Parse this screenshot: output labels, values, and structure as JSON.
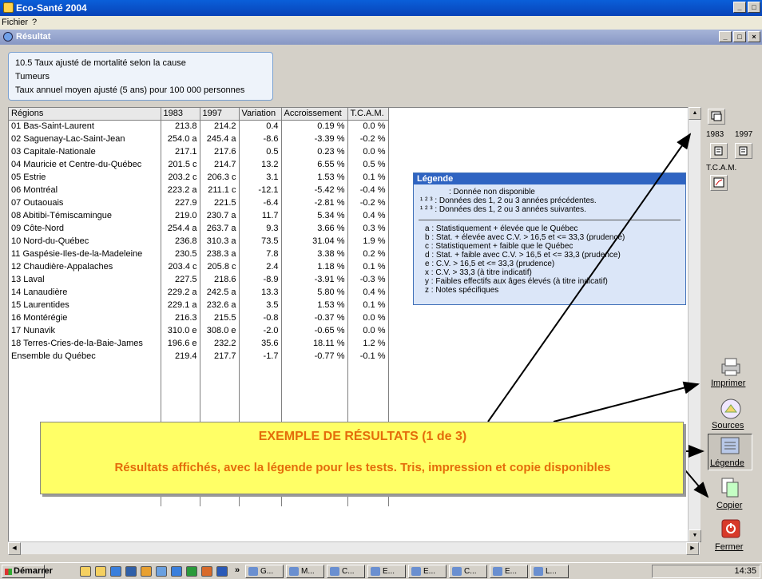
{
  "app": {
    "title": "Eco-Santé 2004",
    "menu": [
      "Fichier",
      "?"
    ]
  },
  "window": {
    "title": "Résultat"
  },
  "info": {
    "line1": "10.5 Taux ajusté de mortalité selon la cause",
    "line2": "Tumeurs",
    "line3": "Taux annuel moyen ajusté (5 ans) pour 100 000 personnes"
  },
  "table": {
    "headers": [
      "Régions",
      "1983",
      "1997",
      "Variation",
      "Accroissement",
      "T.C.A.M."
    ],
    "rows": [
      [
        "01 Bas-Saint-Laurent",
        "213.8",
        "214.2",
        "0.4",
        "0.19 %",
        "0.0 %"
      ],
      [
        "02 Saguenay-Lac-Saint-Jean",
        "254.0 a",
        "245.4 a",
        "-8.6",
        "-3.39 %",
        "-0.2 %"
      ],
      [
        "03 Capitale-Nationale",
        "217.1",
        "217.6",
        "0.5",
        "0.23 %",
        "0.0 %"
      ],
      [
        "04 Mauricie et Centre-du-Québec",
        "201.5 c",
        "214.7",
        "13.2",
        "6.55 %",
        "0.5 %"
      ],
      [
        "05 Estrie",
        "203.2 c",
        "206.3 c",
        "3.1",
        "1.53 %",
        "0.1 %"
      ],
      [
        "06 Montréal",
        "223.2 a",
        "211.1 c",
        "-12.1",
        "-5.42 %",
        "-0.4 %"
      ],
      [
        "07 Outaouais",
        "227.9",
        "221.5",
        "-6.4",
        "-2.81 %",
        "-0.2 %"
      ],
      [
        "08 Abitibi-Témiscamingue",
        "219.0",
        "230.7 a",
        "11.7",
        "5.34 %",
        "0.4 %"
      ],
      [
        "09 Côte-Nord",
        "254.4 a",
        "263.7 a",
        "9.3",
        "3.66 %",
        "0.3 %"
      ],
      [
        "10 Nord-du-Québec",
        "236.8",
        "310.3 a",
        "73.5",
        "31.04 %",
        "1.9 %"
      ],
      [
        "11 Gaspésie-Iles-de-la-Madeleine",
        "230.5",
        "238.3 a",
        "7.8",
        "3.38 %",
        "0.2 %"
      ],
      [
        "12 Chaudière-Appalaches",
        "203.4 c",
        "205.8 c",
        "2.4",
        "1.18 %",
        "0.1 %"
      ],
      [
        "13 Laval",
        "227.5",
        "218.6",
        "-8.9",
        "-3.91 %",
        "-0.3 %"
      ],
      [
        "14 Lanaudière",
        "229.2 a",
        "242.5 a",
        "13.3",
        "5.80 %",
        "0.4 %"
      ],
      [
        "15 Laurentides",
        "229.1 a",
        "232.6 a",
        "3.5",
        "1.53 %",
        "0.1 %"
      ],
      [
        "16 Montérégie",
        "216.3",
        "215.5",
        "-0.8",
        "-0.37 %",
        "0.0 %"
      ],
      [
        "17 Nunavik",
        "310.0 e",
        "308.0 e",
        "-2.0",
        "-0.65 %",
        "0.0 %"
      ],
      [
        "18 Terres-Cries-de-la-Baie-James",
        "196.6 e",
        "232.2",
        "35.6",
        "18.11 %",
        "1.2 %"
      ],
      [
        "Ensemble du Québec",
        "219.4",
        "217.7",
        "-1.7",
        "-0.77 %",
        "-0.1 %"
      ]
    ]
  },
  "legend": {
    "title": "Légende",
    "l1": ": Donnée non disponible",
    "l2": "¹ ² ³ : Données des 1, 2 ou 3 années précédentes.",
    "l3": "¹ ² ³ : Données des 1, 2 ou 3 années suivantes.",
    "items": [
      "a : Statistiquement + élevée que le Québec",
      "b : Stat. + élevée avec C.V. > 16,5 et <= 33,3 (prudence)",
      "c : Statistiquement + faible que le Québec",
      "d : Stat. + faible avec C.V. > 16,5 et <= 33,3 (prudence)",
      "e : C.V. > 16,5 et <= 33,3 (prudence)",
      "x : C.V. > 33,3 (à titre indicatif)",
      "y : Faibles effectifs aux âges élevés (à titre indicatif)",
      "z : Notes spécifiques"
    ]
  },
  "side": {
    "year1": "1983",
    "year2": "1997",
    "tcam": "T.C.A.M.",
    "print": "Imprimer",
    "sources": "Sources",
    "legend": "Légende",
    "copy": "Copier",
    "close": "Fermer"
  },
  "callout": {
    "title": "EXEMPLE DE RÉSULTATS (1 de 3)",
    "text": "Résultats affichés, avec la légende pour les tests. Tris, impression et copie disponibles"
  },
  "taskbar": {
    "start": "Démarrer",
    "tasks": [
      "G...",
      "M...",
      "C...",
      "E...",
      "E...",
      "C...",
      "E...",
      "L..."
    ],
    "clock": "14:35"
  }
}
